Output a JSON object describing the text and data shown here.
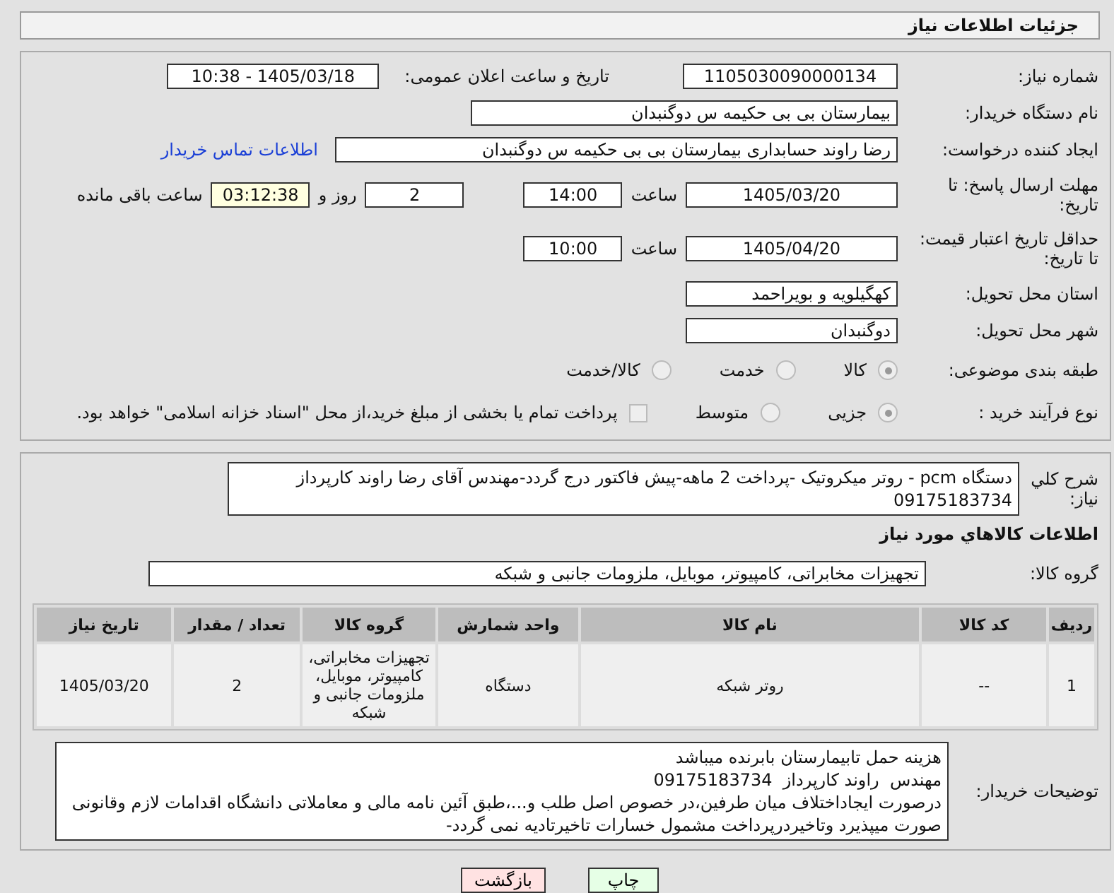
{
  "header": {
    "title": "جزئیات اطلاعات نیاز"
  },
  "details": {
    "need_number": {
      "label": "شماره نیاز:",
      "value": "1105030090000134"
    },
    "announce": {
      "label": "تاریخ و ساعت اعلان عمومی:",
      "value": "1405/03/18 - 10:38"
    },
    "buyer": {
      "label": "نام دستگاه خریدار:",
      "value": "بیمارستان بی بی حکیمه س  دوگنبدان"
    },
    "creator": {
      "label": "ایجاد کننده درخواست:",
      "value": "رضا راوند حسابداری بیمارستان بی بی حکیمه س  دوگنبدان",
      "link": "اطلاعات تماس خریدار"
    },
    "deadline": {
      "label": "مهلت ارسال پاسخ: تا تاریخ:",
      "date": "1405/03/20",
      "time_label": "ساعت",
      "time": "14:00",
      "days": "2",
      "days_label": "روز و",
      "remaining": "03:12:38",
      "remaining_label": "ساعت باقی مانده"
    },
    "validity": {
      "label": "حداقل تاریخ اعتبار قیمت: تا تاریخ:",
      "date": "1405/04/20",
      "time_label": "ساعت",
      "time": "10:00"
    },
    "province": {
      "label": "استان محل تحویل:",
      "value": "کهگیلویه و بویراحمد"
    },
    "city": {
      "label": "شهر محل تحویل:",
      "value": "دوگنبدان"
    },
    "category": {
      "label": "طبقه بندی موضوعی:",
      "options": [
        {
          "label": "کالا",
          "selected": true
        },
        {
          "label": "خدمت",
          "selected": false
        },
        {
          "label": "کالا/خدمت",
          "selected": false
        }
      ]
    },
    "process": {
      "label": "نوع فرآیند خرید :",
      "options": [
        {
          "label": "جزیی",
          "selected": true
        },
        {
          "label": "متوسط",
          "selected": false
        }
      ],
      "payment": {
        "label": "پرداخت تمام یا بخشی از مبلغ خرید،از محل \"اسناد خزانه اسلامی\" خواهد بود.",
        "checked": false
      }
    }
  },
  "summary": {
    "label": "شرح کلي نياز:",
    "value": "دستگاه pcm - روتر میکروتیک -پرداخت 2 ماهه-پیش فاکتور درج گردد-مهندس آقای رضا راوند کارپرداز 09175183734"
  },
  "goods": {
    "heading": "اطلاعات كالاهاي مورد نياز",
    "group": {
      "label": "گروه کالا:",
      "value": "تجهیزات مخابراتی، کامپیوتر، موبایل، ملزومات جانبی و شبکه"
    },
    "table": {
      "columns": [
        "ردیف",
        "کد کالا",
        "نام کالا",
        "واحد شمارش",
        "گروه کالا",
        "تعداد / مقدار",
        "تاریخ نیاز"
      ],
      "rows": [
        [
          "1",
          "--",
          "روتر شبکه",
          "دستگاه",
          "تجهیزات مخابراتی، کامپیوتر، موبایل، ملزومات جانبی و شبکه",
          "2",
          "1405/03/20"
        ]
      ]
    }
  },
  "notes": {
    "label": "توضیحات خریدار:",
    "value": "هزینه حمل تابیمارستان بابرنده میباشد\nمهندس  راوند کارپرداز  09175183734\nدرصورت ایجاداختلاف میان طرفین،در خصوص اصل طلب و...،طبق آئین نامه مالی و معاملاتی دانشگاه اقدامات لازم وقانونی صورت میپذیرد وتاخیردرپرداخت مشمول خسارات تاخیرتادیه نمی گردد-"
  },
  "buttons": [
    {
      "label": "چاپ",
      "kind": "print"
    },
    {
      "label": "بازگشت",
      "kind": "back"
    }
  ]
}
